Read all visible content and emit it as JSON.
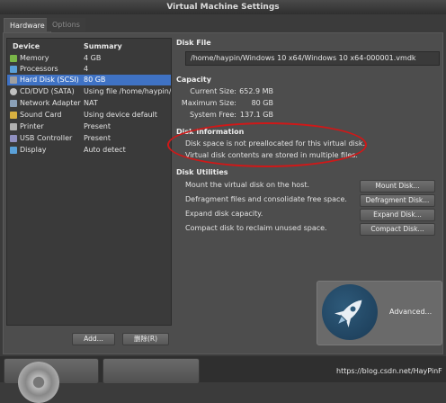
{
  "window": {
    "title": "Virtual Machine Settings"
  },
  "tabs": [
    {
      "label": "Hardware",
      "active": true
    },
    {
      "label": "Options",
      "active": false
    }
  ],
  "device_list": {
    "col_device": "Device",
    "col_summary": "Summary",
    "items": [
      {
        "device": "Memory",
        "summary": "4 GB",
        "icon": "memory-icon",
        "color": "#7ab648"
      },
      {
        "device": "Processors",
        "summary": "4",
        "icon": "processor-icon",
        "color": "#5aa0d8"
      },
      {
        "device": "Hard Disk (SCSI)",
        "summary": "80 GB",
        "icon": "hard-disk-icon",
        "color": "#a0a0a0",
        "selected": true
      },
      {
        "device": "CD/DVD (SATA)",
        "summary": "Using file /home/haypin/u",
        "icon": "cd-icon",
        "color": "#c0c0c0"
      },
      {
        "device": "Network Adapter",
        "summary": "NAT",
        "icon": "network-icon",
        "color": "#8aa0b8"
      },
      {
        "device": "Sound Card",
        "summary": "Using device default",
        "icon": "sound-icon",
        "color": "#d8b040"
      },
      {
        "device": "Printer",
        "summary": "Present",
        "icon": "printer-icon",
        "color": "#b0b0b0"
      },
      {
        "device": "USB Controller",
        "summary": "Present",
        "icon": "usb-icon",
        "color": "#9090c0"
      },
      {
        "device": "Display",
        "summary": "Auto detect",
        "icon": "display-icon",
        "color": "#5aa0d8"
      }
    ],
    "add_label": "Add...",
    "remove_label": "删除(R)"
  },
  "disk_file": {
    "heading": "Disk File",
    "path": "/home/haypin/Windows 10 x64/Windows 10 x64-000001.vmdk"
  },
  "capacity": {
    "heading": "Capacity",
    "current_label": "Current Size:",
    "current_value": "652.9 MB",
    "max_label": "Maximum Size:",
    "max_value": "80 GB",
    "free_label": "System Free:",
    "free_value": "137.1 GB"
  },
  "disk_info": {
    "heading": "Disk Information",
    "line1": "Disk space is not preallocated for this virtual disk.",
    "line2": "Virtual disk contents are stored in multiple files."
  },
  "disk_utilities": {
    "heading": "Disk Utilities",
    "items": [
      {
        "text": "Mount the virtual disk on the host.",
        "button": "Mount Disk..."
      },
      {
        "text": "Defragment files and consolidate free space.",
        "button": "Defragment Disk..."
      },
      {
        "text": "Expand disk capacity.",
        "button": "Expand Disk..."
      },
      {
        "text": "Compact disk to reclaim unused space.",
        "button": "Compact Disk..."
      }
    ]
  },
  "advanced": {
    "label": "Advanced...",
    "icon": "rocket-icon"
  },
  "watermark": "https://blog.csdn.net/HayPinF"
}
